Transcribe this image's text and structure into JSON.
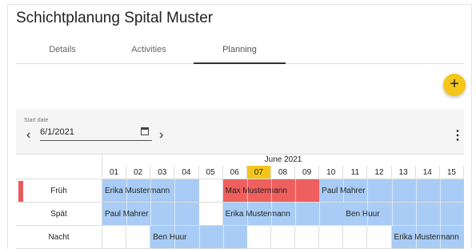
{
  "app": {
    "title": "Schichtplanung Spital Muster"
  },
  "tabs": [
    {
      "label": "Details",
      "active": false
    },
    {
      "label": "Activities",
      "active": false
    },
    {
      "label": "Planning",
      "active": true
    }
  ],
  "fab": {
    "icon": "plus-icon",
    "symbol": "+"
  },
  "toolbar": {
    "start_label": "Start date",
    "start_value": "6/1/2021",
    "prev_symbol": "‹",
    "next_symbol": "›",
    "more_symbol": "⋮"
  },
  "calendar": {
    "month": "June 2021",
    "days": [
      "01",
      "02",
      "03",
      "04",
      "05",
      "06",
      "07",
      "08",
      "09",
      "10",
      "11",
      "12",
      "13",
      "14",
      "15"
    ],
    "today": "07",
    "rows": [
      {
        "label": "Früh",
        "marker": true,
        "assignments": [
          {
            "name": "Erika Mustermann",
            "from": "01",
            "to": "04",
            "color": "#a8ccf5"
          },
          {
            "name": "Max Mustermann",
            "from": "06",
            "to": "09",
            "color": "#ee5f5f"
          },
          {
            "name": "Paul Mahrer",
            "from": "10",
            "to": "15",
            "color": "#a8ccf5"
          }
        ]
      },
      {
        "label": "Spät",
        "marker": false,
        "assignments": [
          {
            "name": "Paul Mahrer",
            "from": "01",
            "to": "04",
            "color": "#a8ccf5"
          },
          {
            "name": "Erika Mustermann",
            "from": "06",
            "to": "10",
            "color": "#a8ccf5"
          },
          {
            "name": "Ben Huur",
            "from": "11",
            "to": "15",
            "color": "#a8ccf5"
          }
        ]
      },
      {
        "label": "Nacht",
        "marker": false,
        "assignments": [
          {
            "name": "Ben Huur",
            "from": "03",
            "to": "06",
            "color": "#a8ccf5"
          },
          {
            "name": "Erika Mustermann",
            "from": "13",
            "to": "15",
            "color": "#a8ccf5"
          }
        ]
      }
    ]
  },
  "colors": {
    "accent": "#f5c518",
    "shift_blue": "#a8ccf5",
    "shift_red": "#ee5f5f"
  }
}
